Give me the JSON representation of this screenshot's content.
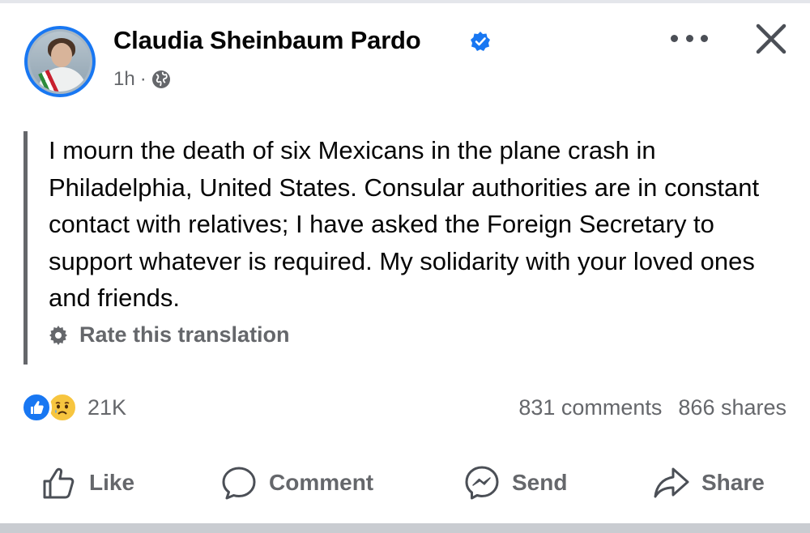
{
  "post": {
    "author": "Claudia Sheinbaum Pardo",
    "timestamp": "1h",
    "separator": "·",
    "text": "I mourn the death of six Mexicans in the plane crash in Philadelphia, United States. Consular authorities are in constant contact with relatives; I have asked the Foreign Secretary to support whatever is required. My solidarity with your loved ones and friends.",
    "translation_label": "Rate this translation"
  },
  "engagement": {
    "reaction_count": "21K",
    "comments": "831 comments",
    "shares": "866 shares"
  },
  "actions": {
    "like": "Like",
    "comment": "Comment",
    "send": "Send",
    "share": "Share"
  },
  "colors": {
    "brand_blue": "#1877f2",
    "secondary_text": "#65676b",
    "primary_text": "#050505",
    "sad_reaction": "#f7c53f"
  },
  "icons": [
    "verified-badge-icon",
    "globe-icon",
    "more-options-icon",
    "close-icon",
    "gear-icon",
    "like-reaction-icon",
    "sad-reaction-icon",
    "like-icon",
    "comment-icon",
    "messenger-send-icon",
    "share-icon"
  ]
}
